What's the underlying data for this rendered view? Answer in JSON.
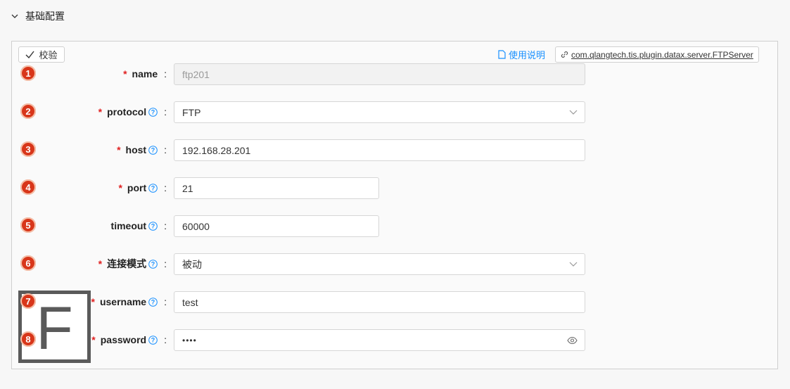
{
  "section": {
    "title": "基础配置"
  },
  "toolbar": {
    "verify_label": "校验",
    "doc_label": "使用说明",
    "plugin_label": "com.qlangtech.tis.plugin.datax.server.FTPServer"
  },
  "logo": {
    "letter": "F"
  },
  "fields": [
    {
      "badge": "1",
      "label": "name",
      "required": "*",
      "colon": ":",
      "value": "ftp201"
    },
    {
      "badge": "2",
      "label": "protocol",
      "required": "*",
      "colon": ":",
      "value": "FTP"
    },
    {
      "badge": "3",
      "label": "host",
      "required": "*",
      "colon": ":",
      "value": "192.168.28.201"
    },
    {
      "badge": "4",
      "label": "port",
      "required": "*",
      "colon": ":",
      "value": "21"
    },
    {
      "badge": "5",
      "label": "timeout",
      "required": "",
      "colon": ":",
      "value": "60000"
    },
    {
      "badge": "6",
      "label": "连接模式",
      "required": "*",
      "colon": ":",
      "value": "被动"
    },
    {
      "badge": "7",
      "label": "username",
      "required": "*",
      "colon": ":",
      "value": "test"
    },
    {
      "badge": "8",
      "label": "password",
      "required": "*",
      "colon": ":",
      "value": "••••"
    }
  ]
}
